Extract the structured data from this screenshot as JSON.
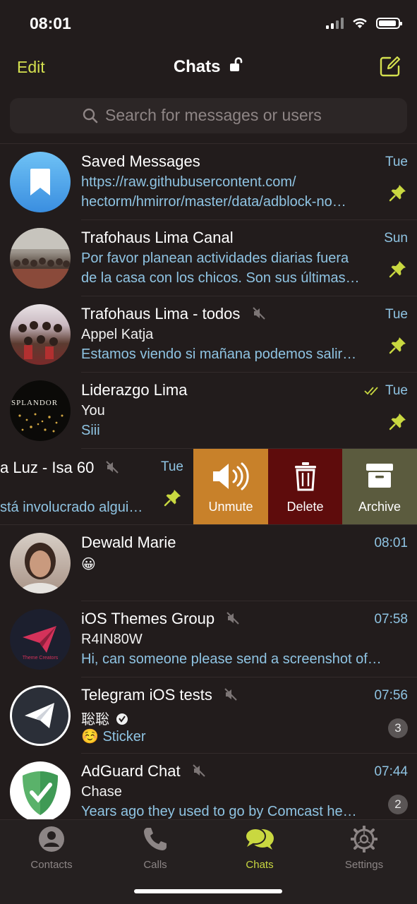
{
  "status": {
    "time": "08:01"
  },
  "nav": {
    "edit_label": "Edit",
    "title": "Chats"
  },
  "search": {
    "placeholder": "Search for messages or users"
  },
  "chats": [
    {
      "name": "Saved Messages",
      "time": "Tue",
      "line1": "https://raw.githubusercontent.com/",
      "line2": "hectorm/hmirror/master/data/adblock-no…",
      "avatar_icon": "bookmark-icon"
    },
    {
      "name": "Trafohaus Lima Canal",
      "time": "Sun",
      "line1": "Por favor planean actividades diarias fuera",
      "line2": "de la casa con los chicos. Son sus últimas…"
    },
    {
      "name": "Trafohaus Lima - todos",
      "time": "Tue",
      "line1": "Appel Katja",
      "line2": "Estamos viendo si mañana podemos salir…"
    },
    {
      "name": "Liderazgo Lima",
      "time": "Tue",
      "line1": "You",
      "line2": "Siii",
      "avatar_text": "SPLANDOR"
    },
    {
      "name": "a Luz - Isa 60",
      "time": "Tue",
      "line2": "stá involucrado algui…"
    },
    {
      "name": "Dewald Marie",
      "time": "08:01",
      "line1": "😀"
    },
    {
      "name": "iOS Themes Group",
      "time": "07:58",
      "line1": "R4IN80W",
      "line2": "Hi, can someone please send a screenshot of…",
      "avatar_text": "Theme Creators"
    },
    {
      "name": "Telegram iOS tests",
      "time": "07:56",
      "line1": "聡聡",
      "line2": "☺️ Sticker",
      "badge": "3"
    },
    {
      "name": "AdGuard Chat",
      "time": "07:44",
      "line1": "Chase",
      "line2": "Years ago they used to go by Comcast he…",
      "badge": "2"
    }
  ],
  "swipe_actions": {
    "unmute": "Unmute",
    "delete": "Delete",
    "archive": "Archive"
  },
  "tabs": [
    {
      "label": "Contacts",
      "icon": "person-icon"
    },
    {
      "label": "Calls",
      "icon": "phone-icon"
    },
    {
      "label": "Chats",
      "icon": "chat-bubbles-icon"
    },
    {
      "label": "Settings",
      "icon": "gear-icon"
    }
  ],
  "colors": {
    "accent": "#d4e04f",
    "link": "#8fc4e3",
    "unmute": "#c8812a",
    "delete": "#5e0c0c",
    "archive": "#5b5b3e"
  }
}
